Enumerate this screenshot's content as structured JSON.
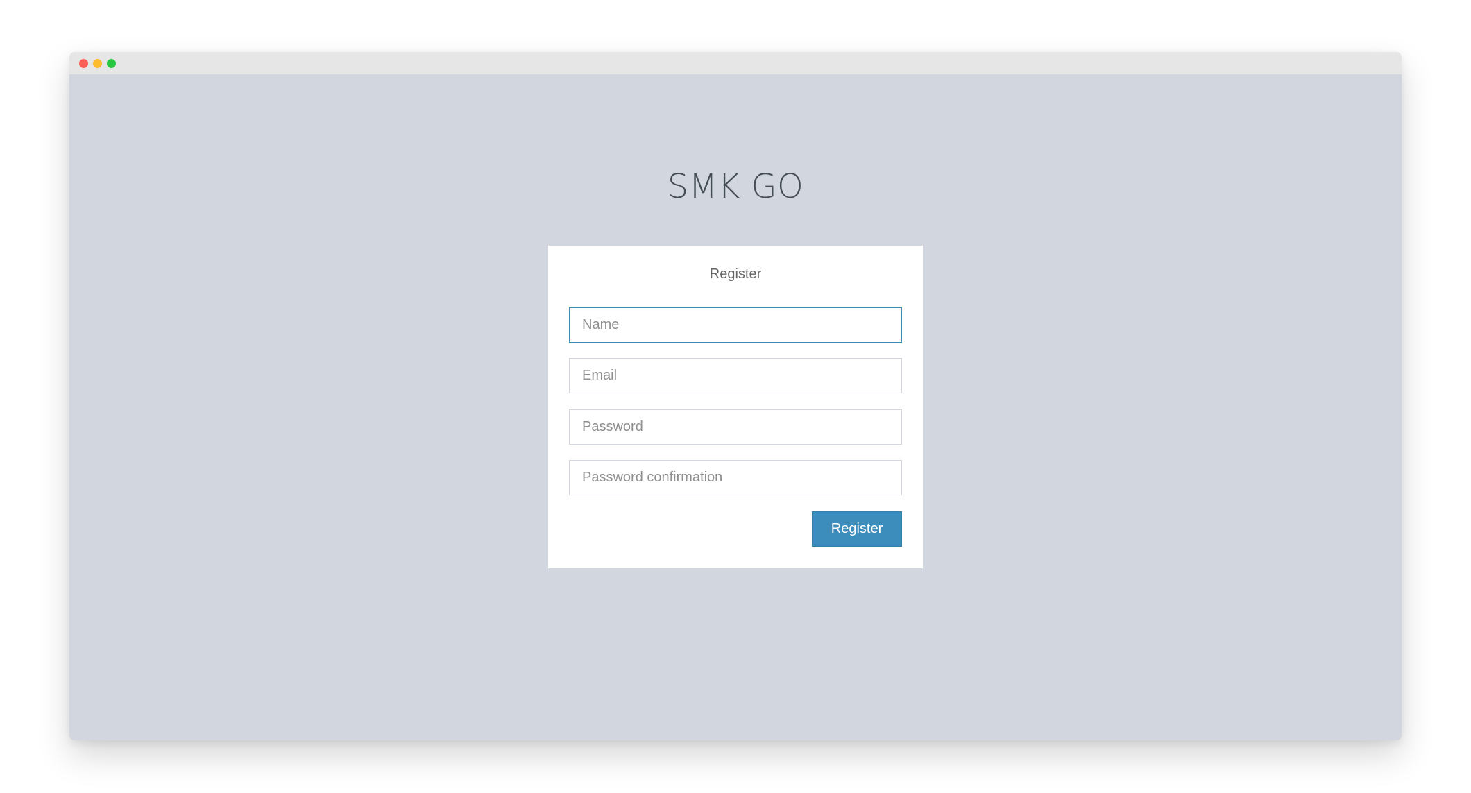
{
  "window": {
    "controls": [
      "close",
      "minimize",
      "maximize"
    ]
  },
  "logo": {
    "text": "SMK GO"
  },
  "register_box": {
    "title": "Register",
    "fields": [
      {
        "placeholder": "Name",
        "value": ""
      },
      {
        "placeholder": "Email",
        "value": ""
      },
      {
        "placeholder": "Password",
        "value": ""
      },
      {
        "placeholder": "Password confirmation",
        "value": ""
      }
    ],
    "submit_label": "Register"
  },
  "colors": {
    "background": "#d2d6de",
    "accent": "#3c8dbc",
    "titlebar": "#e6e6e6"
  }
}
